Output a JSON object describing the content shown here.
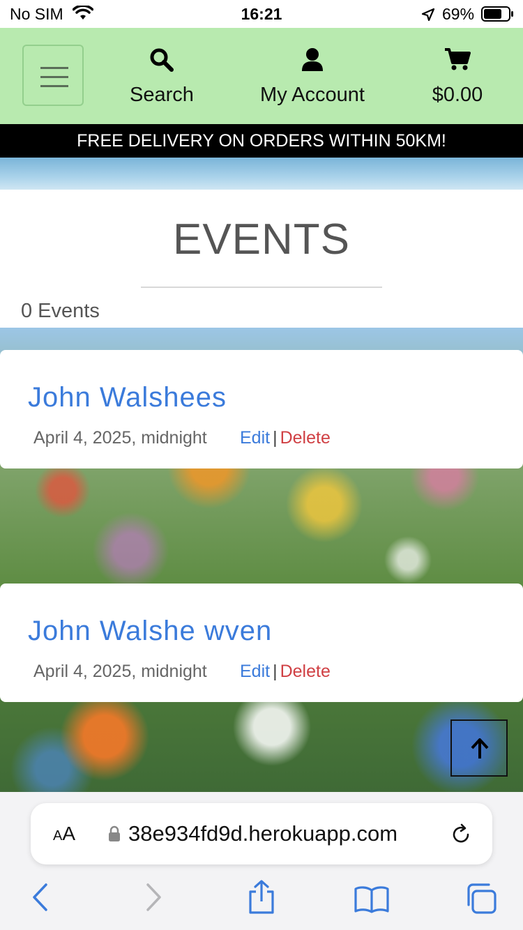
{
  "status_bar": {
    "carrier": "No SIM",
    "time": "16:21",
    "battery": "69%"
  },
  "header": {
    "search_label": "Search",
    "account_label": "My Account",
    "cart_total": "$0.00"
  },
  "banner": {
    "text": "FREE DELIVERY ON ORDERS WITHIN 50KM!"
  },
  "events": {
    "title": "EVENTS",
    "count": "0 Events",
    "items": [
      {
        "name": "John Walshees",
        "date": "April 4, 2025, midnight",
        "edit": "Edit",
        "separator": "|",
        "delete": "Delete"
      },
      {
        "name": "John Walshe wven",
        "date": "April 4, 2025, midnight",
        "edit": "Edit",
        "separator": "|",
        "delete": "Delete"
      }
    ]
  },
  "browser": {
    "aa_small": "A",
    "aa_large": "A",
    "url": "38e934fd9d.herokuapp.com"
  },
  "colors": {
    "header_bg": "#b8eaaf",
    "link_blue": "#3b7bdb",
    "delete_red": "#d04044",
    "banner_bg": "#000000"
  },
  "icons": [
    "wifi-icon",
    "location-arrow-icon",
    "battery-icon",
    "hamburger-menu-icon",
    "search-icon",
    "user-icon",
    "cart-icon",
    "arrow-up-icon",
    "lock-icon",
    "reload-icon",
    "back-chevron-icon",
    "forward-chevron-icon",
    "share-icon",
    "bookmarks-icon",
    "tabs-icon"
  ]
}
